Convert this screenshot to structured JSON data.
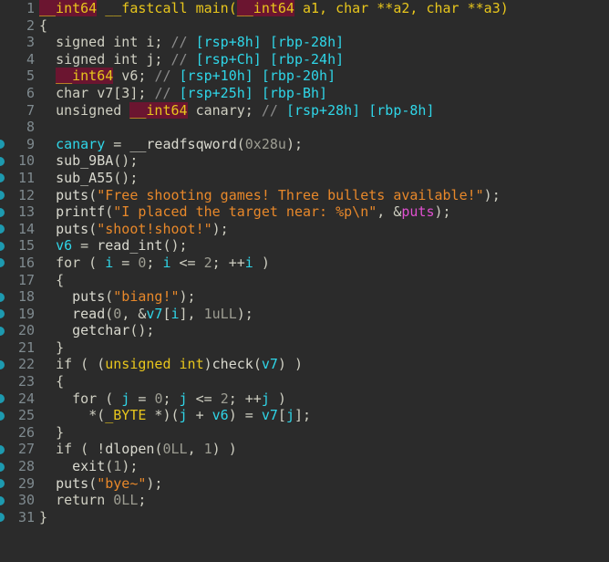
{
  "app": {
    "view_name": "Pseudocode-A",
    "theme": "ida-dark",
    "background_color": "#2b2b2b",
    "colors": {
      "linenumber": "#7f8a8f",
      "marker": "#1d9ab0",
      "type": "#e8c61c",
      "type_highlight_bg": "#6b1530",
      "variable": "#2fd6e8",
      "comment": "#8c8c8c",
      "comment_value": "#2fd6e8",
      "string": "#e8882a",
      "number": "#9d9d92",
      "function": "#d9d9cf",
      "import": "#e050d0",
      "plain": "#cfcfc2"
    }
  },
  "code": {
    "language": "c-pseudocode",
    "function_name": "main",
    "first_line": 1,
    "last_line": 31,
    "lines": [
      {
        "number": "1",
        "marker": false,
        "indent": 0,
        "text": "__int64 __fastcall main(__int64 a1, char **a2, char **a3)",
        "tokens": [
          {
            "t": "__int64",
            "c": "t-typehl"
          },
          {
            "t": " ",
            "c": "t-plain"
          },
          {
            "t": "__fastcall",
            "c": "t-type"
          },
          {
            "t": " ",
            "c": "t-plain"
          },
          {
            "t": "main",
            "c": "t-type"
          },
          {
            "t": "(",
            "c": "t-type"
          },
          {
            "t": "__int64",
            "c": "t-typehl"
          },
          {
            "t": " a1, ",
            "c": "t-type"
          },
          {
            "t": "char",
            "c": "t-type"
          },
          {
            "t": " **a2, ",
            "c": "t-type"
          },
          {
            "t": "char",
            "c": "t-type"
          },
          {
            "t": " **a3)",
            "c": "t-type"
          }
        ]
      },
      {
        "number": "2",
        "marker": false,
        "indent": 0,
        "text": "{",
        "tokens": [
          {
            "t": "{",
            "c": "t-plain"
          }
        ]
      },
      {
        "number": "3",
        "marker": false,
        "indent": 1,
        "text": "signed int i; // [rsp+8h] [rbp-28h]",
        "tokens": [
          {
            "t": "signed int i; ",
            "c": "t-plain"
          },
          {
            "t": "// ",
            "c": "t-comment"
          },
          {
            "t": "[rsp+8h] [rbp-28h]",
            "c": "t-cmtval"
          }
        ]
      },
      {
        "number": "4",
        "marker": false,
        "indent": 1,
        "text": "signed int j; // [rsp+Ch] [rbp-24h]",
        "tokens": [
          {
            "t": "signed int j; ",
            "c": "t-plain"
          },
          {
            "t": "// ",
            "c": "t-comment"
          },
          {
            "t": "[rsp+Ch] [rbp-24h]",
            "c": "t-cmtval"
          }
        ]
      },
      {
        "number": "5",
        "marker": false,
        "indent": 1,
        "text": "__int64 v6; // [rsp+10h] [rbp-20h]",
        "tokens": [
          {
            "t": "__int64",
            "c": "t-typehl"
          },
          {
            "t": " v6; ",
            "c": "t-plain"
          },
          {
            "t": "// ",
            "c": "t-comment"
          },
          {
            "t": "[rsp+10h] [rbp-20h]",
            "c": "t-cmtval"
          }
        ]
      },
      {
        "number": "6",
        "marker": false,
        "indent": 1,
        "text": "char v7[3]; // [rsp+25h] [rbp-Bh]",
        "tokens": [
          {
            "t": "char v7[3]; ",
            "c": "t-plain"
          },
          {
            "t": "// ",
            "c": "t-comment"
          },
          {
            "t": "[rsp+25h] [rbp-Bh]",
            "c": "t-cmtval"
          }
        ]
      },
      {
        "number": "7",
        "marker": false,
        "indent": 1,
        "text": "unsigned __int64 canary; // [rsp+28h] [rbp-8h]",
        "tokens": [
          {
            "t": "unsigned ",
            "c": "t-plain"
          },
          {
            "t": "__int64",
            "c": "t-typehl"
          },
          {
            "t": " canary; ",
            "c": "t-plain"
          },
          {
            "t": "// ",
            "c": "t-comment"
          },
          {
            "t": "[rsp+28h] [rbp-8h]",
            "c": "t-cmtval"
          }
        ]
      },
      {
        "number": "8",
        "marker": false,
        "indent": 0,
        "text": "",
        "tokens": []
      },
      {
        "number": "9",
        "marker": true,
        "indent": 1,
        "text": "canary = __readfsqword(0x28u);",
        "tokens": [
          {
            "t": "canary",
            "c": "t-var"
          },
          {
            "t": " = ",
            "c": "t-plain"
          },
          {
            "t": "__readfsqword",
            "c": "t-func"
          },
          {
            "t": "(",
            "c": "t-plain"
          },
          {
            "t": "0x28u",
            "c": "t-num"
          },
          {
            "t": ");",
            "c": "t-plain"
          }
        ]
      },
      {
        "number": "10",
        "marker": true,
        "indent": 1,
        "text": "sub_9BA();",
        "tokens": [
          {
            "t": "sub_9BA",
            "c": "t-func"
          },
          {
            "t": "();",
            "c": "t-plain"
          }
        ]
      },
      {
        "number": "11",
        "marker": true,
        "indent": 1,
        "text": "sub_A55();",
        "tokens": [
          {
            "t": "sub_A55",
            "c": "t-func"
          },
          {
            "t": "();",
            "c": "t-plain"
          }
        ]
      },
      {
        "number": "12",
        "marker": true,
        "indent": 1,
        "text": "puts(\"Free shooting games! Three bullets available!\");",
        "tokens": [
          {
            "t": "puts",
            "c": "t-func"
          },
          {
            "t": "(",
            "c": "t-plain"
          },
          {
            "t": "\"Free shooting games! Three bullets available!\"",
            "c": "t-string"
          },
          {
            "t": ");",
            "c": "t-plain"
          }
        ]
      },
      {
        "number": "13",
        "marker": true,
        "indent": 1,
        "text": "printf(\"I placed the target near: %p\\n\", &puts);",
        "tokens": [
          {
            "t": "printf",
            "c": "t-func"
          },
          {
            "t": "(",
            "c": "t-plain"
          },
          {
            "t": "\"I placed the target near: %p\\n\"",
            "c": "t-string"
          },
          {
            "t": ", &",
            "c": "t-plain"
          },
          {
            "t": "puts",
            "c": "t-import"
          },
          {
            "t": ");",
            "c": "t-plain"
          }
        ]
      },
      {
        "number": "14",
        "marker": true,
        "indent": 1,
        "text": "puts(\"shoot!shoot!\");",
        "tokens": [
          {
            "t": "puts",
            "c": "t-func"
          },
          {
            "t": "(",
            "c": "t-plain"
          },
          {
            "t": "\"shoot!shoot!\"",
            "c": "t-string"
          },
          {
            "t": ");",
            "c": "t-plain"
          }
        ]
      },
      {
        "number": "15",
        "marker": true,
        "indent": 1,
        "text": "v6 = read_int();",
        "tokens": [
          {
            "t": "v6",
            "c": "t-var"
          },
          {
            "t": " = ",
            "c": "t-plain"
          },
          {
            "t": "read_int",
            "c": "t-func"
          },
          {
            "t": "();",
            "c": "t-plain"
          }
        ]
      },
      {
        "number": "16",
        "marker": true,
        "indent": 1,
        "text": "for ( i = 0; i <= 2; ++i )",
        "tokens": [
          {
            "t": "for ( ",
            "c": "t-plain"
          },
          {
            "t": "i",
            "c": "t-var"
          },
          {
            "t": " = ",
            "c": "t-plain"
          },
          {
            "t": "0",
            "c": "t-num"
          },
          {
            "t": "; ",
            "c": "t-plain"
          },
          {
            "t": "i",
            "c": "t-var"
          },
          {
            "t": " <= ",
            "c": "t-plain"
          },
          {
            "t": "2",
            "c": "t-num"
          },
          {
            "t": "; ++",
            "c": "t-plain"
          },
          {
            "t": "i",
            "c": "t-var"
          },
          {
            "t": " )",
            "c": "t-plain"
          }
        ]
      },
      {
        "number": "17",
        "marker": false,
        "indent": 1,
        "text": "{",
        "tokens": [
          {
            "t": "{",
            "c": "t-plain"
          }
        ]
      },
      {
        "number": "18",
        "marker": true,
        "indent": 2,
        "text": "puts(\"biang!\");",
        "tokens": [
          {
            "t": "puts",
            "c": "t-func"
          },
          {
            "t": "(",
            "c": "t-plain"
          },
          {
            "t": "\"biang!\"",
            "c": "t-string"
          },
          {
            "t": ");",
            "c": "t-plain"
          }
        ]
      },
      {
        "number": "19",
        "marker": true,
        "indent": 2,
        "text": "read(0, &v7[i], 1uLL);",
        "tokens": [
          {
            "t": "read",
            "c": "t-func"
          },
          {
            "t": "(",
            "c": "t-plain"
          },
          {
            "t": "0",
            "c": "t-num"
          },
          {
            "t": ", &",
            "c": "t-plain"
          },
          {
            "t": "v7",
            "c": "t-var"
          },
          {
            "t": "[",
            "c": "t-plain"
          },
          {
            "t": "i",
            "c": "t-var"
          },
          {
            "t": "], ",
            "c": "t-plain"
          },
          {
            "t": "1uLL",
            "c": "t-num"
          },
          {
            "t": ");",
            "c": "t-plain"
          }
        ]
      },
      {
        "number": "20",
        "marker": true,
        "indent": 2,
        "text": "getchar();",
        "tokens": [
          {
            "t": "getchar",
            "c": "t-func"
          },
          {
            "t": "();",
            "c": "t-plain"
          }
        ]
      },
      {
        "number": "21",
        "marker": false,
        "indent": 1,
        "text": "}",
        "tokens": [
          {
            "t": "}",
            "c": "t-plain"
          }
        ]
      },
      {
        "number": "22",
        "marker": true,
        "indent": 1,
        "text": "if ( (unsigned int)check(v7) )",
        "tokens": [
          {
            "t": "if ( (",
            "c": "t-plain"
          },
          {
            "t": "unsigned int",
            "c": "t-type"
          },
          {
            "t": ")",
            "c": "t-plain"
          },
          {
            "t": "check",
            "c": "t-func"
          },
          {
            "t": "(",
            "c": "t-plain"
          },
          {
            "t": "v7",
            "c": "t-var"
          },
          {
            "t": ") )",
            "c": "t-plain"
          }
        ]
      },
      {
        "number": "23",
        "marker": false,
        "indent": 1,
        "text": "{",
        "tokens": [
          {
            "t": "{",
            "c": "t-plain"
          }
        ]
      },
      {
        "number": "24",
        "marker": true,
        "indent": 2,
        "text": "for ( j = 0; j <= 2; ++j )",
        "tokens": [
          {
            "t": "for ( ",
            "c": "t-plain"
          },
          {
            "t": "j",
            "c": "t-var"
          },
          {
            "t": " = ",
            "c": "t-plain"
          },
          {
            "t": "0",
            "c": "t-num"
          },
          {
            "t": "; ",
            "c": "t-plain"
          },
          {
            "t": "j",
            "c": "t-var"
          },
          {
            "t": " <= ",
            "c": "t-plain"
          },
          {
            "t": "2",
            "c": "t-num"
          },
          {
            "t": "; ++",
            "c": "t-plain"
          },
          {
            "t": "j",
            "c": "t-var"
          },
          {
            "t": " )",
            "c": "t-plain"
          }
        ]
      },
      {
        "number": "25",
        "marker": true,
        "indent": 3,
        "text": "*(_BYTE *)(j + v6) = v7[j];",
        "tokens": [
          {
            "t": "*(",
            "c": "t-plain"
          },
          {
            "t": "_BYTE",
            "c": "t-type"
          },
          {
            "t": " *)(",
            "c": "t-plain"
          },
          {
            "t": "j",
            "c": "t-var"
          },
          {
            "t": " + ",
            "c": "t-plain"
          },
          {
            "t": "v6",
            "c": "t-var"
          },
          {
            "t": ") = ",
            "c": "t-plain"
          },
          {
            "t": "v7",
            "c": "t-var"
          },
          {
            "t": "[",
            "c": "t-plain"
          },
          {
            "t": "j",
            "c": "t-var"
          },
          {
            "t": "];",
            "c": "t-plain"
          }
        ]
      },
      {
        "number": "26",
        "marker": false,
        "indent": 1,
        "text": "}",
        "tokens": [
          {
            "t": "}",
            "c": "t-plain"
          }
        ]
      },
      {
        "number": "27",
        "marker": true,
        "indent": 1,
        "text": "if ( !dlopen(0LL, 1) )",
        "tokens": [
          {
            "t": "if ( !",
            "c": "t-plain"
          },
          {
            "t": "dlopen",
            "c": "t-func"
          },
          {
            "t": "(",
            "c": "t-plain"
          },
          {
            "t": "0LL",
            "c": "t-num"
          },
          {
            "t": ", ",
            "c": "t-plain"
          },
          {
            "t": "1",
            "c": "t-num"
          },
          {
            "t": ") )",
            "c": "t-plain"
          }
        ]
      },
      {
        "number": "28",
        "marker": true,
        "indent": 2,
        "text": "exit(1);",
        "tokens": [
          {
            "t": "exit",
            "c": "t-func"
          },
          {
            "t": "(",
            "c": "t-plain"
          },
          {
            "t": "1",
            "c": "t-num"
          },
          {
            "t": ");",
            "c": "t-plain"
          }
        ]
      },
      {
        "number": "29",
        "marker": true,
        "indent": 1,
        "text": "puts(\"bye~\");",
        "tokens": [
          {
            "t": "puts",
            "c": "t-func"
          },
          {
            "t": "(",
            "c": "t-plain"
          },
          {
            "t": "\"bye~\"",
            "c": "t-string"
          },
          {
            "t": ");",
            "c": "t-plain"
          }
        ]
      },
      {
        "number": "30",
        "marker": true,
        "indent": 1,
        "text": "return 0LL;",
        "tokens": [
          {
            "t": "return ",
            "c": "t-plain"
          },
          {
            "t": "0LL",
            "c": "t-num"
          },
          {
            "t": ";",
            "c": "t-plain"
          }
        ]
      },
      {
        "number": "31",
        "marker": true,
        "indent": 0,
        "text": "}",
        "tokens": [
          {
            "t": "}",
            "c": "t-plain"
          }
        ]
      }
    ]
  }
}
